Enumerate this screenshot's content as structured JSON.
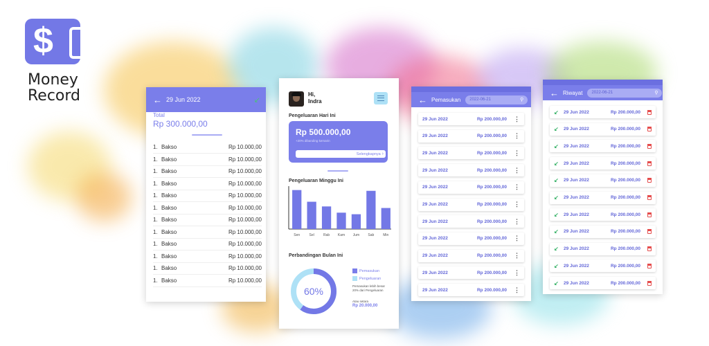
{
  "brand": {
    "line1": "Money",
    "line2": "Record",
    "logo_icon": "dollar-card-icon"
  },
  "colors": {
    "primary": "#7a7eea",
    "accent_light": "#aee1f6",
    "danger": "#e54c4c",
    "income": "#3bb36a"
  },
  "detail": {
    "date": "29 Jun 2022",
    "total_label": "Total",
    "total_value": "Rp 300.000,00",
    "items": [
      {
        "no": "1.",
        "name": "Bakso",
        "price": "Rp 10.000,00"
      },
      {
        "no": "1.",
        "name": "Bakso",
        "price": "Rp 10.000,00"
      },
      {
        "no": "1.",
        "name": "Bakso",
        "price": "Rp 10.000,00"
      },
      {
        "no": "1.",
        "name": "Bakso",
        "price": "Rp 10.000,00"
      },
      {
        "no": "1.",
        "name": "Bakso",
        "price": "Rp 10.000,00"
      },
      {
        "no": "1.",
        "name": "Bakso",
        "price": "Rp 10.000,00"
      },
      {
        "no": "1.",
        "name": "Bakso",
        "price": "Rp 10.000,00"
      },
      {
        "no": "1.",
        "name": "Bakso",
        "price": "Rp 10.000,00"
      },
      {
        "no": "1.",
        "name": "Bakso",
        "price": "Rp 10.000,00"
      },
      {
        "no": "1.",
        "name": "Bakso",
        "price": "Rp 10.000,00"
      },
      {
        "no": "1.",
        "name": "Bakso",
        "price": "Rp 10.000,00"
      },
      {
        "no": "1.",
        "name": "Bakso",
        "price": "Rp 10.000,00"
      }
    ]
  },
  "home": {
    "greeting_line1": "Hi,",
    "greeting_line2": "Indra",
    "today_title": "Pengeluaran Hari Ini",
    "today_amount": "Rp 500.000,00",
    "today_note": "+20% dibanding kemarin",
    "more_label": "Selengkapnya",
    "week_title": "Pengeluaran Minggu Ini",
    "compare_title": "Perbandingan Bulan Ini",
    "legend_income": "Pemasukan",
    "legend_expense": "Pengeluaran",
    "compare_note": "Pemasukan lebih besar 20% dari Pengeluaran",
    "or_label": "Atau setara",
    "or_value": "Rp 20.000,00"
  },
  "chart_data": [
    {
      "type": "bar",
      "title": "Pengeluaran Minggu Ini",
      "categories": [
        "Sen",
        "Sel",
        "Rab",
        "Kam",
        "Jum",
        "Sab",
        "Min"
      ],
      "values": [
        100,
        70,
        58,
        42,
        38,
        98,
        54
      ],
      "ylim": [
        0,
        110
      ]
    },
    {
      "type": "pie",
      "title": "Perbandingan Bulan Ini",
      "series": [
        {
          "name": "Pemasukan",
          "values": [
            60
          ]
        },
        {
          "name": "Pengeluaran",
          "values": [
            40
          ]
        }
      ],
      "center_label": "60%"
    }
  ],
  "income": {
    "title": "Pemasukan",
    "search_value": "2022-06-21",
    "rows": [
      {
        "date": "29 Jun 2022",
        "amount": "Rp 200.000,00"
      },
      {
        "date": "29 Jun 2022",
        "amount": "Rp 200.000,00"
      },
      {
        "date": "29 Jun 2022",
        "amount": "Rp 200.000,00"
      },
      {
        "date": "29 Jun 2022",
        "amount": "Rp 200.000,00"
      },
      {
        "date": "29 Jun 2022",
        "amount": "Rp 200.000,00"
      },
      {
        "date": "29 Jun 2022",
        "amount": "Rp 200.000,00"
      },
      {
        "date": "29 Jun 2022",
        "amount": "Rp 200.000,00"
      },
      {
        "date": "29 Jun 2022",
        "amount": "Rp 200.000,00"
      },
      {
        "date": "29 Jun 2022",
        "amount": "Rp 200.000,00"
      },
      {
        "date": "29 Jun 2022",
        "amount": "Rp 200.000,00"
      },
      {
        "date": "29 Jun 2022",
        "amount": "Rp 200.000,00"
      }
    ]
  },
  "history": {
    "title": "Riwayat",
    "search_value": "2022-06-21",
    "rows": [
      {
        "date": "29 Jun 2022",
        "amount": "Rp 200.000,00"
      },
      {
        "date": "29 Jun 2022",
        "amount": "Rp 200.000,00"
      },
      {
        "date": "29 Jun 2022",
        "amount": "Rp 200.000,00"
      },
      {
        "date": "29 Jun 2022",
        "amount": "Rp 200.000,00"
      },
      {
        "date": "29 Jun 2022",
        "amount": "Rp 200.000,00"
      },
      {
        "date": "29 Jun 2022",
        "amount": "Rp 200.000,00"
      },
      {
        "date": "29 Jun 2022",
        "amount": "Rp 200.000,00"
      },
      {
        "date": "29 Jun 2022",
        "amount": "Rp 200.000,00"
      },
      {
        "date": "29 Jun 2022",
        "amount": "Rp 200.000,00"
      },
      {
        "date": "29 Jun 2022",
        "amount": "Rp 200.000,00"
      },
      {
        "date": "29 Jun 2022",
        "amount": "Rp 200.000,00"
      }
    ]
  }
}
